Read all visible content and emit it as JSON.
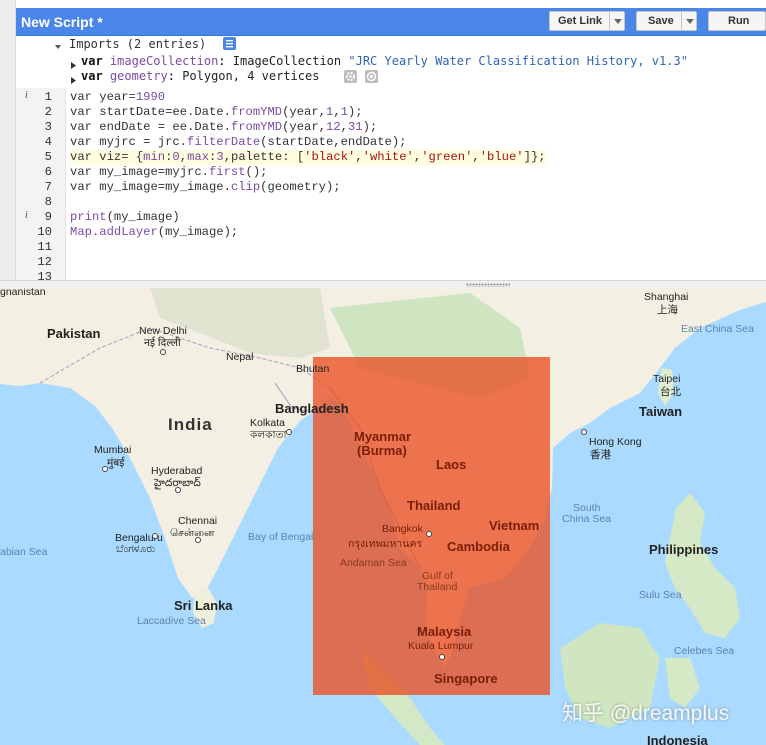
{
  "editor": {
    "script_title": "New Script *",
    "buttons": {
      "get_link": "Get Link",
      "save": "Save",
      "run": "Run"
    },
    "imports": {
      "header": "Imports (2 entries)",
      "entries": [
        {
          "keyword": "var",
          "name": "imageCollection",
          "colon": ":",
          "type": "ImageCollection",
          "value": "\"JRC Yearly Water Classification History, v1.3\""
        },
        {
          "keyword": "var",
          "name": "geometry",
          "colon": ":",
          "type": "Polygon, 4 vertices"
        }
      ]
    },
    "line_numbers": [
      "1",
      "2",
      "3",
      "4",
      "5",
      "6",
      "7",
      "8",
      "9",
      "10",
      "11",
      "12",
      "13"
    ],
    "code": {
      "l1": {
        "a": "var year=",
        "b": "1990"
      },
      "l2": {
        "a": "var startDate=ee.Date.",
        "b": "fromYMD",
        "c": "(year,",
        "d": "1",
        "e": ",",
        "f": "1",
        "g": ");"
      },
      "l3": {
        "a": "var endDate = ee.Date.",
        "b": "fromYMD",
        "c": "(year,",
        "d": "12",
        "e": ",",
        "f": "31",
        "g": ");"
      },
      "l4": {
        "a": "var myjrc = jrc.",
        "b": "filterDate",
        "c": "(startDate,endDate);"
      },
      "l5": {
        "a": "var viz= {",
        "b": "min",
        "c": ":",
        "d": "0",
        "e": ",",
        "f": "max",
        "g": ":",
        "h": "3",
        "i": ",palette: [",
        "j": "'black'",
        "k": ",",
        "l": "'white'",
        "m": ",",
        "n": "'green'",
        "o": ",",
        "p": "'blue'",
        "q": "]};"
      },
      "l6": {
        "a": "var my_image=myjrc.",
        "b": "first",
        "c": "();"
      },
      "l7": {
        "a": "var my_image=my_image.",
        "b": "clip",
        "c": "(geometry);"
      },
      "l9": {
        "a": "print",
        "b": "(my_image)"
      },
      "l10": {
        "a": "Map.",
        "b": "addLayer",
        "c": "(my_image);"
      }
    }
  },
  "map": {
    "labels": {
      "top_cut": "gnanistan",
      "pakistan": "Pakistan",
      "new_delhi": "New Delhi",
      "new_delhi_native": "नई दिल्ली",
      "nepal": "Nepal",
      "bhutan": "Bhutan",
      "india": "India",
      "kolkata": "Kolkata",
      "kolkata_native": "কলকাতা",
      "bangladesh": "Bangladesh",
      "mumbai": "Mumbai",
      "mumbai_native": "मुंबई",
      "hyderabad": "Hyderabad",
      "hyderabad_native": "హైదరాబాద్",
      "chennai": "Chennai",
      "chennai_native": "சென்னை",
      "bengaluru": "Bengaluru",
      "bengaluru_native": "ಬೆಂಗಳೂರು",
      "arabian_sea": "abian Sea",
      "bay_of_bengal": "Bay of Bengal",
      "sri_lanka": "Sri Lanka",
      "laccadive_sea": "Laccadive Sea",
      "myanmar": "Myanmar",
      "burma": "(Burma)",
      "laos": "Laos",
      "thailand": "Thailand",
      "bangkok": "Bangkok",
      "bangkok_native": "กรุงเทพมหานคร",
      "vietnam": "Vietnam",
      "cambodia": "Cambodia",
      "andaman_sea": "Andaman Sea",
      "gulf_of": "Gulf of",
      "gulf_thailand": "Thailand",
      "malaysia": "Malaysia",
      "kuala_lumpur": "Kuala Lumpur",
      "singapore": "Singapore",
      "shanghai": "Shanghai",
      "shanghai_native": "上海",
      "east_china_sea": "East China Sea",
      "taipei": "Taipei",
      "taipei_native": "台北",
      "taiwan": "Taiwan",
      "hong_kong": "Hong Kong",
      "hong_kong_native": "香港",
      "south_china_sea_1": "South",
      "south_china_sea_2": "China Sea",
      "philippines": "Philippines",
      "sulu_sea": "Sulu Sea",
      "celebes_sea": "Celebes Sea",
      "indonesia": "Indonesia"
    },
    "watermark": "知乎 @dreamplus",
    "colors": {
      "water": "#aadaff",
      "land": "#f5f0e4",
      "forest": "#cfe6c1",
      "overlay": "#e9502380"
    }
  }
}
